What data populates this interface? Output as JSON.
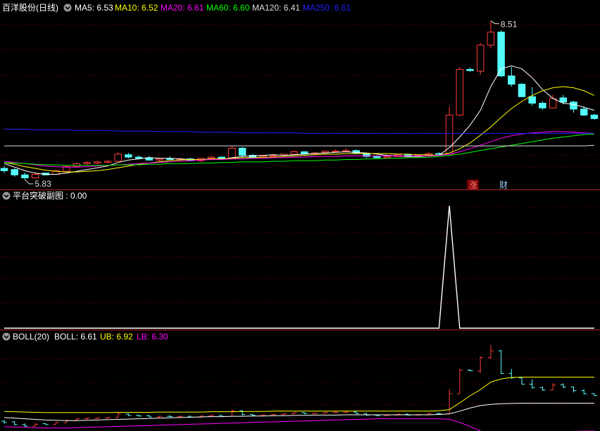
{
  "colors": {
    "background": "#000000",
    "grid": "#8B0000",
    "separator": "#B22222",
    "up": "#FF3B3B",
    "down": "#54FCFC",
    "ma5": "#FFFFFF",
    "ma10": "#FFFF00",
    "ma20": "#FF00FF",
    "ma60": "#00FF00",
    "ma120": "#DDDDDD",
    "ma250": "#2020FF",
    "signal": "#FFFFFF"
  },
  "header": {
    "stock_title": "百洋股份(日线)",
    "ma5": "MA5: 6.53",
    "ma10": "MA10: 6.52",
    "ma20": "MA20: 6.61",
    "ma60": "MA60: 6.60",
    "ma120": "MA120: 6.41",
    "ma250": "MA250: 6.61",
    "high_label": "8.51",
    "low_label": "5.83",
    "badge_zhang": "涨",
    "badge_cai": "财"
  },
  "panel2": {
    "title": "平台突破副图 : 0.00"
  },
  "panel3": {
    "boll_name": "BOLL(20)",
    "boll": "BOLL: 6.61",
    "ub": "UB: 6.92",
    "lb": "LB: 6.30"
  },
  "icons": [
    "collapse-circle-icon"
  ],
  "chart_data": [
    {
      "type": "candlestick",
      "title": "百洋股份(日线)",
      "ylim": [
        5.7,
        8.6
      ],
      "annotations": [
        {
          "label": "8.51",
          "at": "high"
        },
        {
          "label": "5.83",
          "at": "low"
        }
      ],
      "candles": [
        [
          6.02,
          6.06,
          5.94,
          5.98
        ],
        [
          6.0,
          6.02,
          5.88,
          5.91
        ],
        [
          5.91,
          5.95,
          5.83,
          5.86
        ],
        [
          5.86,
          5.96,
          5.85,
          5.92
        ],
        [
          5.94,
          5.95,
          5.9,
          5.91
        ],
        [
          5.92,
          6.0,
          5.91,
          5.98
        ],
        [
          5.97,
          6.07,
          5.96,
          6.05
        ],
        [
          6.05,
          6.12,
          6.04,
          6.1
        ],
        [
          6.1,
          6.14,
          6.08,
          6.12
        ],
        [
          6.11,
          6.15,
          6.09,
          6.13
        ],
        [
          6.12,
          6.16,
          6.1,
          6.14
        ],
        [
          6.14,
          6.3,
          6.13,
          6.26
        ],
        [
          6.25,
          6.28,
          6.19,
          6.21
        ],
        [
          6.21,
          6.24,
          6.17,
          6.19
        ],
        [
          6.2,
          6.23,
          6.15,
          6.16
        ],
        [
          6.16,
          6.2,
          6.14,
          6.18
        ],
        [
          6.18,
          6.22,
          6.16,
          6.17
        ],
        [
          6.17,
          6.2,
          6.15,
          6.18
        ],
        [
          6.18,
          6.2,
          6.14,
          6.15
        ],
        [
          6.15,
          6.2,
          6.13,
          6.19
        ],
        [
          6.19,
          6.23,
          6.18,
          6.21
        ],
        [
          6.21,
          6.22,
          6.17,
          6.18
        ],
        [
          6.18,
          6.4,
          6.17,
          6.36
        ],
        [
          6.36,
          6.38,
          6.2,
          6.24
        ],
        [
          6.24,
          6.26,
          6.19,
          6.21
        ],
        [
          6.21,
          6.24,
          6.19,
          6.23
        ],
        [
          6.23,
          6.26,
          6.21,
          6.24
        ],
        [
          6.24,
          6.27,
          6.22,
          6.26
        ],
        [
          6.26,
          6.32,
          6.25,
          6.3
        ],
        [
          6.3,
          6.31,
          6.25,
          6.27
        ],
        [
          6.27,
          6.3,
          6.26,
          6.28
        ],
        [
          6.29,
          6.32,
          6.27,
          6.31
        ],
        [
          6.31,
          6.34,
          6.3,
          6.31
        ],
        [
          6.31,
          6.36,
          6.3,
          6.32
        ],
        [
          6.32,
          6.34,
          6.26,
          6.27
        ],
        [
          6.27,
          6.28,
          6.2,
          6.22
        ],
        [
          6.22,
          6.24,
          6.19,
          6.2
        ],
        [
          6.2,
          6.23,
          6.19,
          6.22
        ],
        [
          6.22,
          6.26,
          6.21,
          6.25
        ],
        [
          6.25,
          6.26,
          6.2,
          6.22
        ],
        [
          6.22,
          6.25,
          6.21,
          6.24
        ],
        [
          6.24,
          6.29,
          6.23,
          6.27
        ],
        [
          6.27,
          6.29,
          6.24,
          6.26
        ],
        [
          6.26,
          7.06,
          6.25,
          6.92
        ],
        [
          6.92,
          7.73,
          6.91,
          7.69
        ],
        [
          7.69,
          7.72,
          7.65,
          7.67
        ],
        [
          7.66,
          8.14,
          7.6,
          8.1
        ],
        [
          8.1,
          8.51,
          8.05,
          8.32
        ],
        [
          8.32,
          8.35,
          7.56,
          7.58
        ],
        [
          7.58,
          7.73,
          7.4,
          7.44
        ],
        [
          7.44,
          7.46,
          7.22,
          7.23
        ],
        [
          7.23,
          7.39,
          7.08,
          7.12
        ],
        [
          7.12,
          7.15,
          7.01,
          7.04
        ],
        [
          7.04,
          7.26,
          7.03,
          7.2
        ],
        [
          7.21,
          7.26,
          7.1,
          7.14
        ],
        [
          7.14,
          7.16,
          6.96,
          7.02
        ],
        [
          7.02,
          7.07,
          6.9,
          6.92
        ],
        [
          6.92,
          6.94,
          6.84,
          6.86
        ]
      ],
      "series": [
        {
          "name": "MA5",
          "values": [
            6.1,
            6.04,
            5.98,
            5.94,
            5.92,
            5.92,
            5.94,
            5.97,
            6.0,
            6.03,
            6.06,
            6.12,
            6.16,
            6.18,
            6.2,
            6.19,
            6.19,
            6.18,
            6.17,
            6.17,
            6.17,
            6.17,
            6.2,
            6.22,
            6.23,
            6.24,
            6.25,
            6.24,
            6.25,
            6.26,
            6.27,
            6.28,
            6.29,
            6.3,
            6.29,
            6.28,
            6.26,
            6.24,
            6.23,
            6.22,
            6.22,
            6.23,
            6.24,
            6.37,
            6.55,
            6.75,
            7.0,
            7.4,
            7.7,
            7.75,
            7.7,
            7.55,
            7.35,
            7.2,
            7.12,
            7.1,
            7.05,
            7.0
          ]
        },
        {
          "name": "MA10",
          "values": [
            6.12,
            6.09,
            6.05,
            6.02,
            5.99,
            5.97,
            5.96,
            5.96,
            5.97,
            5.98,
            6.0,
            6.03,
            6.06,
            6.09,
            6.11,
            6.13,
            6.15,
            6.16,
            6.17,
            6.17,
            6.18,
            6.18,
            6.19,
            6.2,
            6.2,
            6.21,
            6.21,
            6.22,
            6.23,
            6.24,
            6.25,
            6.26,
            6.26,
            6.27,
            6.27,
            6.27,
            6.27,
            6.27,
            6.26,
            6.26,
            6.25,
            6.25,
            6.24,
            6.28,
            6.35,
            6.45,
            6.58,
            6.72,
            6.88,
            7.03,
            7.15,
            7.25,
            7.33,
            7.38,
            7.4,
            7.38,
            7.33,
            7.25
          ]
        },
        {
          "name": "MA20",
          "values": [
            6.14,
            6.12,
            6.1,
            6.08,
            6.06,
            6.05,
            6.04,
            6.04,
            6.05,
            6.06,
            6.07,
            6.08,
            6.09,
            6.1,
            6.11,
            6.12,
            6.13,
            6.14,
            6.15,
            6.16,
            6.17,
            6.17,
            6.18,
            6.18,
            6.19,
            6.19,
            6.2,
            6.2,
            6.21,
            6.21,
            6.22,
            6.22,
            6.22,
            6.23,
            6.23,
            6.23,
            6.23,
            6.23,
            6.23,
            6.23,
            6.23,
            6.23,
            6.24,
            6.26,
            6.3,
            6.35,
            6.41,
            6.47,
            6.53,
            6.57,
            6.6,
            6.62,
            6.63,
            6.64,
            6.64,
            6.63,
            6.62,
            6.61
          ]
        },
        {
          "name": "MA60",
          "values": [
            6.12,
            6.11,
            6.1,
            6.09,
            6.08,
            6.08,
            6.07,
            6.07,
            6.07,
            6.07,
            6.07,
            6.08,
            6.08,
            6.08,
            6.09,
            6.09,
            6.1,
            6.1,
            6.1,
            6.11,
            6.11,
            6.12,
            6.12,
            6.13,
            6.13,
            6.13,
            6.14,
            6.14,
            6.15,
            6.15,
            6.15,
            6.16,
            6.16,
            6.17,
            6.17,
            6.18,
            6.18,
            6.19,
            6.19,
            6.2,
            6.2,
            6.21,
            6.22,
            6.24,
            6.26,
            6.29,
            6.32,
            6.35,
            6.38,
            6.41,
            6.44,
            6.47,
            6.5,
            6.53,
            6.55,
            6.57,
            6.59,
            6.6
          ]
        },
        {
          "name": "MA120",
          "values": [
            6.4,
            6.4,
            6.4,
            6.4,
            6.4,
            6.4,
            6.4,
            6.4,
            6.4,
            6.4,
            6.4,
            6.4,
            6.4,
            6.4,
            6.4,
            6.4,
            6.4,
            6.4,
            6.4,
            6.4,
            6.4,
            6.4,
            6.4,
            6.4,
            6.4,
            6.4,
            6.4,
            6.4,
            6.4,
            6.4,
            6.4,
            6.4,
            6.4,
            6.4,
            6.4,
            6.4,
            6.4,
            6.4,
            6.4,
            6.4,
            6.4,
            6.4,
            6.4,
            6.4,
            6.4,
            6.4,
            6.4,
            6.4,
            6.4,
            6.4,
            6.4,
            6.4,
            6.4,
            6.4,
            6.4,
            6.4,
            6.4,
            6.41
          ]
        },
        {
          "name": "MA250",
          "values": [
            6.68,
            6.68,
            6.68,
            6.67,
            6.67,
            6.67,
            6.67,
            6.66,
            6.66,
            6.66,
            6.66,
            6.65,
            6.65,
            6.65,
            6.65,
            6.64,
            6.64,
            6.64,
            6.64,
            6.63,
            6.63,
            6.63,
            6.63,
            6.62,
            6.62,
            6.62,
            6.62,
            6.62,
            6.62,
            6.61,
            6.61,
            6.61,
            6.61,
            6.61,
            6.61,
            6.61,
            6.61,
            6.61,
            6.61,
            6.61,
            6.61,
            6.61,
            6.61,
            6.61,
            6.61,
            6.61,
            6.61,
            6.61,
            6.61,
            6.61,
            6.61,
            6.61,
            6.61,
            6.61,
            6.61,
            6.61,
            6.61,
            6.61
          ]
        }
      ]
    },
    {
      "type": "line",
      "title": "平台突破副图",
      "ylim": [
        0,
        1
      ],
      "series": [
        {
          "name": "平台突破副图",
          "values": [
            0,
            0,
            0,
            0,
            0,
            0,
            0,
            0,
            0,
            0,
            0,
            0,
            0,
            0,
            0,
            0,
            0,
            0,
            0,
            0,
            0,
            0,
            0,
            0,
            0,
            0,
            0,
            0,
            0,
            0,
            0,
            0,
            0,
            0,
            0,
            0,
            0,
            0,
            0,
            0,
            0,
            0,
            0,
            1,
            0,
            0,
            0,
            0,
            0,
            0,
            0,
            0,
            0,
            0,
            0,
            0,
            0,
            0
          ]
        }
      ]
    },
    {
      "type": "line",
      "title": "BOLL(20)",
      "ylim": [
        5.7,
        8.6
      ],
      "series": [
        {
          "name": "BOLL",
          "values": [
            6.14,
            6.12,
            6.1,
            6.08,
            6.06,
            6.05,
            6.04,
            6.04,
            6.05,
            6.06,
            6.07,
            6.08,
            6.09,
            6.1,
            6.11,
            6.12,
            6.13,
            6.14,
            6.15,
            6.16,
            6.17,
            6.17,
            6.18,
            6.18,
            6.19,
            6.19,
            6.2,
            6.2,
            6.21,
            6.21,
            6.22,
            6.22,
            6.22,
            6.23,
            6.23,
            6.23,
            6.23,
            6.23,
            6.23,
            6.23,
            6.23,
            6.23,
            6.24,
            6.26,
            6.35,
            6.45,
            6.53,
            6.57,
            6.59,
            6.6,
            6.61,
            6.61,
            6.61,
            6.61,
            6.61,
            6.61,
            6.61,
            6.61
          ]
        },
        {
          "name": "UB",
          "values": [
            6.34,
            6.33,
            6.32,
            6.31,
            6.3,
            6.3,
            6.3,
            6.3,
            6.3,
            6.3,
            6.3,
            6.31,
            6.31,
            6.31,
            6.31,
            6.32,
            6.32,
            6.32,
            6.32,
            6.32,
            6.33,
            6.33,
            6.33,
            6.34,
            6.34,
            6.34,
            6.35,
            6.35,
            6.35,
            6.35,
            6.35,
            6.35,
            6.35,
            6.35,
            6.35,
            6.35,
            6.35,
            6.35,
            6.35,
            6.35,
            6.35,
            6.35,
            6.36,
            6.4,
            6.62,
            6.85,
            7.05,
            7.3,
            7.4,
            7.45,
            7.46,
            7.46,
            7.46,
            7.46,
            7.46,
            7.46,
            7.46,
            7.46
          ]
        },
        {
          "name": "LB",
          "values": [
            5.84,
            5.83,
            5.82,
            5.81,
            5.8,
            5.8,
            5.8,
            5.81,
            5.82,
            5.83,
            5.84,
            5.85,
            5.86,
            5.87,
            5.88,
            5.89,
            5.9,
            5.91,
            5.92,
            5.93,
            5.94,
            5.95,
            5.96,
            5.97,
            5.98,
            5.99,
            6.0,
            6.01,
            6.02,
            6.03,
            6.04,
            6.05,
            6.06,
            6.07,
            6.08,
            6.09,
            6.1,
            6.1,
            6.1,
            6.1,
            6.1,
            6.1,
            6.1,
            6.08,
            5.98,
            5.85,
            5.7,
            5.62,
            5.62,
            5.63,
            5.64,
            5.65,
            5.66,
            5.67,
            5.68,
            5.69,
            5.7,
            5.7
          ]
        }
      ]
    }
  ]
}
